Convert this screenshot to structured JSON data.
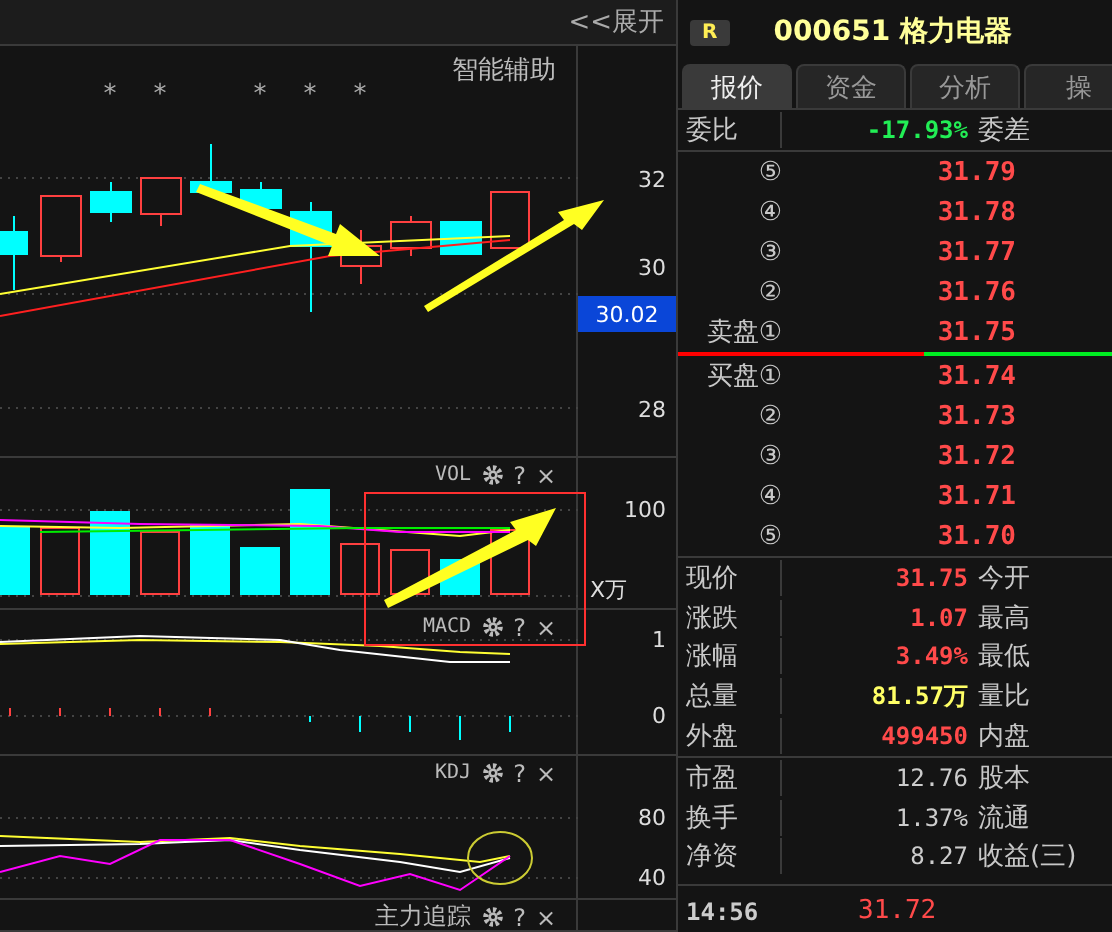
{
  "left_header": {
    "expand_button": "<<展开"
  },
  "main_chart": {
    "title": "智能辅助",
    "star_marks": [
      "*",
      "*",
      "*",
      "*",
      "*"
    ],
    "price_ticks": [
      "32",
      "30",
      "28"
    ],
    "current_price_tag": "30.02"
  },
  "indicator_panels": [
    {
      "kind": "vol",
      "name": "VOL",
      "controls": [
        "?",
        "×"
      ],
      "ticks": [
        "100"
      ],
      "unit": "X万"
    },
    {
      "kind": "macd",
      "name": "MACD",
      "controls": [
        "?",
        "×"
      ],
      "ticks": [
        "1",
        "0"
      ]
    },
    {
      "kind": "kdj",
      "name": "KDJ",
      "controls": [
        "?",
        "×"
      ],
      "ticks": [
        "80",
        "40"
      ]
    },
    {
      "kind": "tracking",
      "name": "主力追踪",
      "controls": [
        "?",
        "×"
      ]
    }
  ],
  "quote": {
    "market_badge": "R",
    "code": "000651",
    "name": "格力电器",
    "tabs": [
      {
        "label": "报价",
        "selected": true
      },
      {
        "label": "资金",
        "selected": false
      },
      {
        "label": "分析",
        "selected": false
      },
      {
        "label": "操",
        "selected": false
      }
    ],
    "commission": {
      "label": "委比",
      "value": "-17.93%",
      "label2": "委差",
      "color": "#22ee55"
    },
    "asks": [
      {
        "label": "⑤",
        "price": "31.79"
      },
      {
        "label": "④",
        "price": "31.78"
      },
      {
        "label": "③",
        "price": "31.77"
      },
      {
        "label": "②",
        "price": "31.76"
      },
      {
        "label": "卖盘①",
        "price": "31.75"
      }
    ],
    "bids": [
      {
        "label": "买盘①",
        "price": "31.74"
      },
      {
        "label": "②",
        "price": "31.73"
      },
      {
        "label": "③",
        "price": "31.72"
      },
      {
        "label": "④",
        "price": "31.71"
      },
      {
        "label": "⑤",
        "price": "31.70"
      }
    ],
    "stats": [
      {
        "label": "现价",
        "value": "31.75",
        "label2": "今开",
        "color": "#ff4a4a"
      },
      {
        "label": "涨跌",
        "value": "1.07",
        "label2": "最高",
        "color": "#ff4a4a"
      },
      {
        "label": "涨幅",
        "value": "3.49%",
        "label2": "最低",
        "color": "#ff4a4a"
      },
      {
        "label": "总量",
        "value": "81.57万",
        "label2": "量比",
        "color": "#ffff66"
      },
      {
        "label": "外盘",
        "value": "499450",
        "label2": "内盘",
        "color": "#ff4a4a"
      }
    ],
    "fundamentals": [
      {
        "label": "市盈",
        "value": "12.76",
        "label2": "股本"
      },
      {
        "label": "换手",
        "value": "1.37%",
        "label2": "流通"
      },
      {
        "label": "净资",
        "value": "8.27",
        "label2": "收益(三)"
      }
    ],
    "last_trade": {
      "time": "14:56",
      "price": "31.72"
    }
  }
}
